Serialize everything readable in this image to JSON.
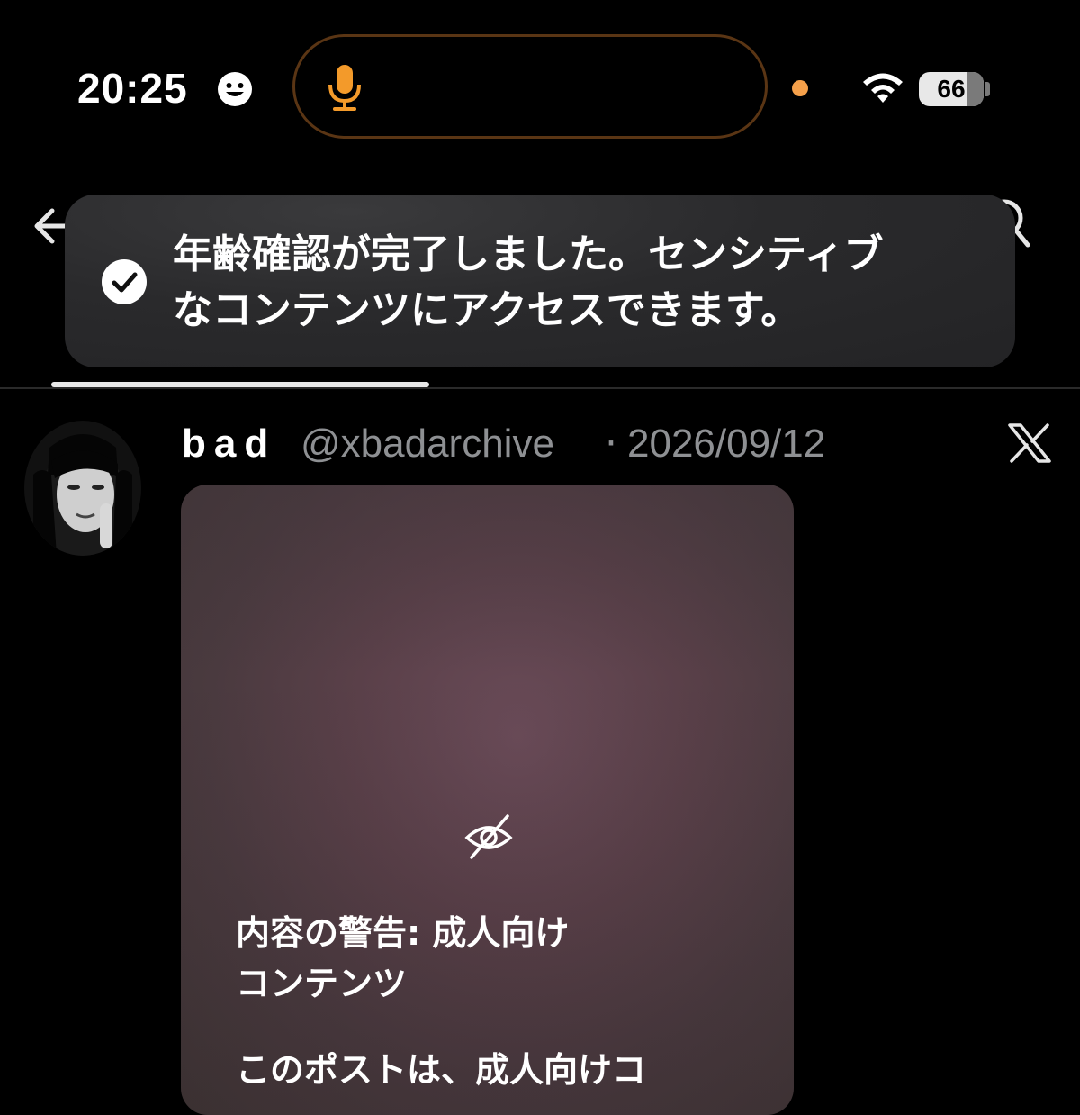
{
  "status_bar": {
    "time": "20:25",
    "face_icon": "smile-face-icon",
    "mic_icon": "microphone-icon",
    "privacy_dot_color": "#f5a04a",
    "accent_color": "#f39a2a",
    "wifi_icon": "wifi-icon",
    "battery_level": "66"
  },
  "header": {
    "back_icon": "back-arrow-icon",
    "search_icon": "search-icon"
  },
  "toast": {
    "icon": "check-circle-icon",
    "line1": "年齢確認が完了しました。センシティブ",
    "line2": "なコンテンツにアクセスできます。"
  },
  "post": {
    "author_name": "bad",
    "handle": "@xbadarchive",
    "separator": "·",
    "date": "2026/09/12",
    "platform_icon": "x-logo-icon",
    "media": {
      "hidden_icon": "eye-off-icon",
      "warning_line1": "内容の警告: 成人向け",
      "warning_line2": "コンテンツ",
      "warning_body": "このポストは、成人向けコ"
    }
  }
}
